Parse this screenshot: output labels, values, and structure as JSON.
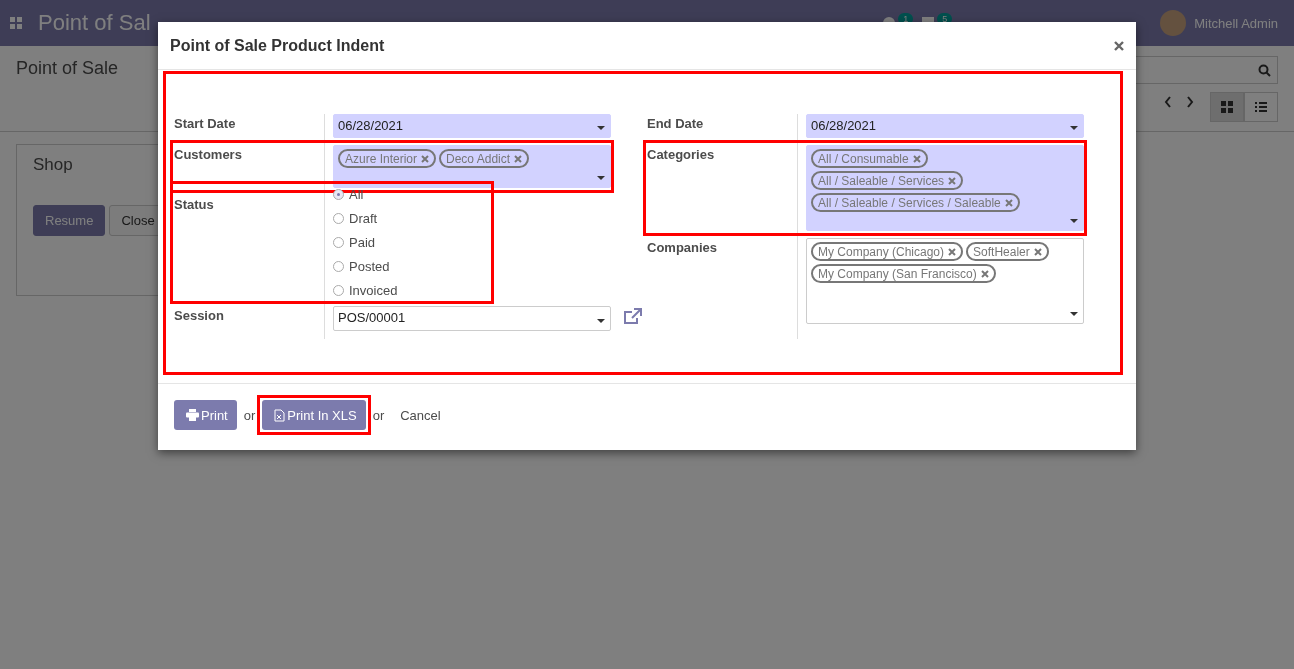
{
  "navbar": {
    "app_name": "Point of Sal",
    "activity_count": "1",
    "message_count": "5",
    "user": "Mitchell Admin"
  },
  "control_panel": {
    "breadcrumb": "Point of Sale"
  },
  "kanban": {
    "title": "Shop",
    "buttons": [
      "Resume",
      "Close"
    ]
  },
  "dialog": {
    "title": "Point of Sale Product Indent",
    "highlighted": true,
    "left_fields": [
      {
        "kind": "date",
        "label": "Start Date",
        "value": "06/28/2021",
        "required": true,
        "highlighted": false
      },
      {
        "kind": "tags",
        "label": "Customers",
        "tags": [
          "Azure Interior",
          "Deco Addict"
        ],
        "required": true,
        "highlighted": true
      },
      {
        "kind": "radio",
        "label": "Status",
        "options": [
          {
            "label": "All",
            "selected": true
          },
          {
            "label": "Draft",
            "selected": false
          },
          {
            "label": "Paid",
            "selected": false
          },
          {
            "label": "Posted",
            "selected": false
          },
          {
            "label": "Invoiced",
            "selected": false
          }
        ],
        "highlighted": true
      },
      {
        "kind": "select",
        "label": "Session",
        "value": "POS/00001",
        "required": false,
        "highlighted": false
      }
    ],
    "right_fields": [
      {
        "kind": "date",
        "label": "End Date",
        "value": "06/28/2021",
        "required": true,
        "highlighted": false
      },
      {
        "kind": "tags",
        "label": "Categories",
        "tags": [
          "All / Consumable",
          "All / Saleable / Services",
          "All / Saleable / Services / Saleable"
        ],
        "required": true,
        "highlighted": true
      },
      {
        "kind": "tags",
        "label": "Companies",
        "tags": [
          "My Company (Chicago)",
          "SoftHealer",
          "My Company (San Francisco)"
        ],
        "required": false,
        "highlighted": false
      }
    ],
    "footer": [
      {
        "kind": "print_button",
        "label": "Print",
        "highlighted": false
      },
      {
        "kind": "text",
        "label": "or"
      },
      {
        "kind": "xls_button",
        "label": "Print In XLS",
        "highlighted": true
      },
      {
        "kind": "text",
        "label": "or"
      },
      {
        "kind": "link",
        "label": "Cancel"
      }
    ]
  }
}
